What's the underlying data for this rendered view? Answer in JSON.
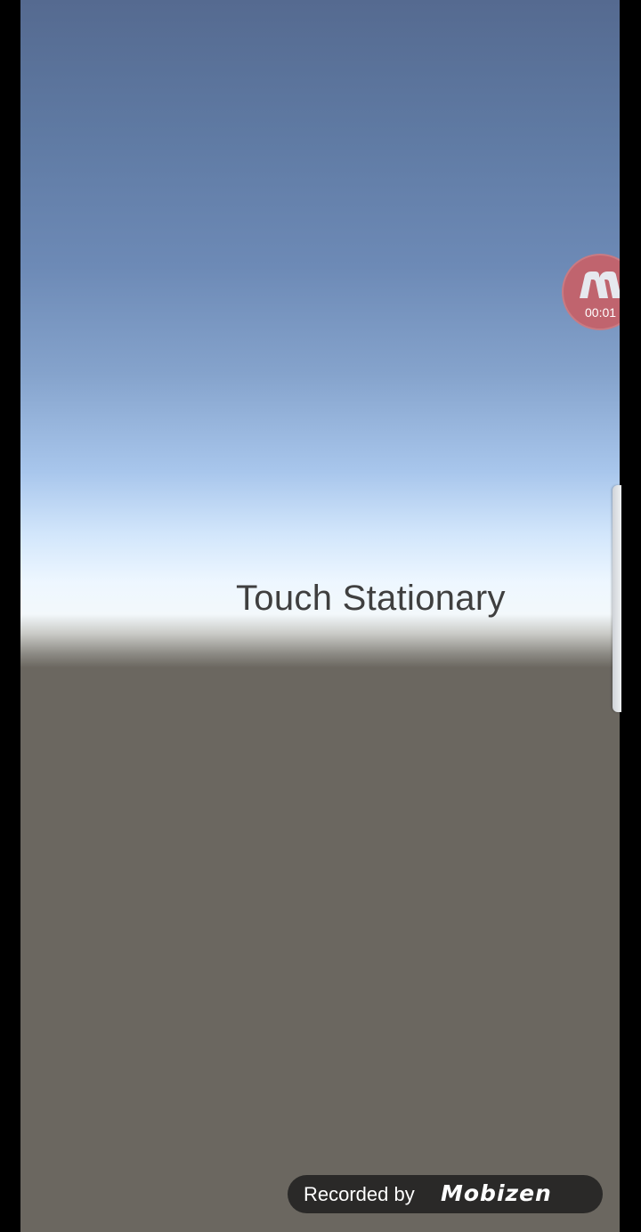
{
  "scene": {
    "sky_top_color": "#556a90",
    "horizon_color": "#f3f8fb",
    "ground_color": "#6b6760",
    "touch_status": "Touch Stationary"
  },
  "recorder_bubble": {
    "icon": "mobizen-m-icon",
    "timer": "00:01",
    "color": "#c0646e"
  },
  "watermark": {
    "text": "Recorded by",
    "logo": "Mobizen"
  }
}
